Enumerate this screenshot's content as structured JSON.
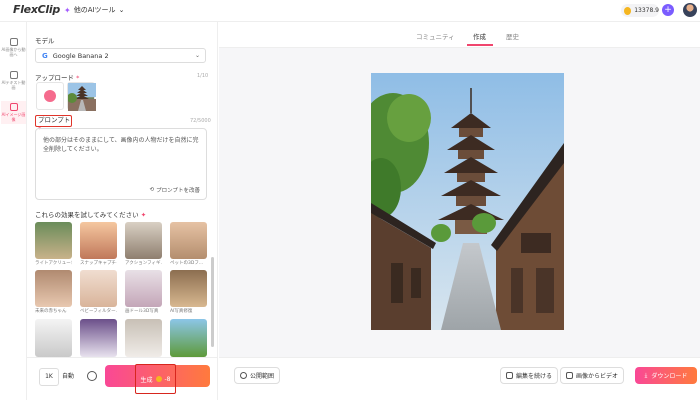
{
  "topbar": {
    "logo": "FlexClip",
    "tools_menu": "他のAIツール",
    "credits": "13378.9"
  },
  "rail": {
    "items": [
      {
        "label": "AI画像から動画へ",
        "icon": "video-icon"
      },
      {
        "label": "AIテキスト動画",
        "icon": "text-video-icon"
      },
      {
        "label": "AIイメージ画像",
        "icon": "image-icon"
      }
    ]
  },
  "panel": {
    "model_label": "モデル",
    "model_value": "Google Banana 2",
    "upload_label": "アップロード",
    "upload_count": "1/10",
    "prompt_label": "プロンプト",
    "prompt_count": "72/5000",
    "prompt_text": "他の部分はそのままにして、画像内の人物だけを自然に完全削除してください。",
    "prompt_enhance": "プロンプトを改善",
    "effects_label": "これらの効果を試してみてください",
    "effects": [
      {
        "caption": "ライトアクリューシ..."
      },
      {
        "caption": "スナップキャプチャ..."
      },
      {
        "caption": "アクションフィギ..."
      },
      {
        "caption": "ペットの3Dフ..."
      },
      {
        "caption": "未来の赤ちゃん"
      },
      {
        "caption": "ベビーフィルター..."
      },
      {
        "caption": "画ドール3D写真"
      },
      {
        "caption": "AI写真修復"
      },
      {
        "caption": ""
      },
      {
        "caption": ""
      },
      {
        "caption": ""
      },
      {
        "caption": ""
      }
    ]
  },
  "bottom_left": {
    "resolution": "1K",
    "auto": "自動",
    "generate": "生成",
    "cost": "-8"
  },
  "main": {
    "tabs": [
      {
        "label": "コミュニティ"
      },
      {
        "label": "作成"
      },
      {
        "label": "歴史"
      }
    ]
  },
  "bottom_main": {
    "public_scope": "公開範囲",
    "continue_edit": "編集を続ける",
    "image_to_video": "画像からビデオ",
    "download": "ダウンロード"
  },
  "colors": {
    "accent": "#f0466e",
    "gradient_start": "#f94896",
    "gradient_end": "#ff7a3d",
    "highlight_border": "#e0342a"
  }
}
